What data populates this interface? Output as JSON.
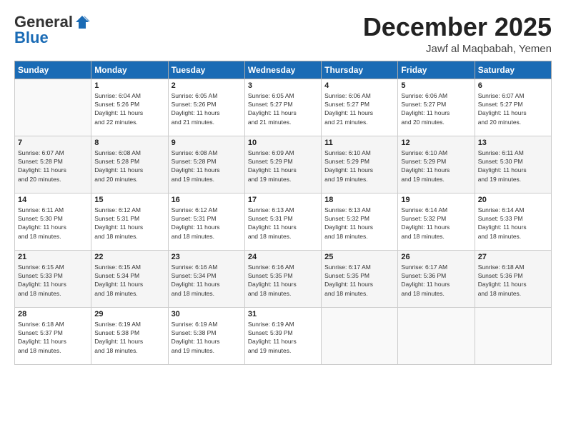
{
  "header": {
    "logo_general": "General",
    "logo_blue": "Blue",
    "month_title": "December 2025",
    "location": "Jawf al Maqbabah, Yemen"
  },
  "days_of_week": [
    "Sunday",
    "Monday",
    "Tuesday",
    "Wednesday",
    "Thursday",
    "Friday",
    "Saturday"
  ],
  "weeks": [
    [
      {
        "day": "",
        "info": ""
      },
      {
        "day": "1",
        "info": "Sunrise: 6:04 AM\nSunset: 5:26 PM\nDaylight: 11 hours\nand 22 minutes."
      },
      {
        "day": "2",
        "info": "Sunrise: 6:05 AM\nSunset: 5:26 PM\nDaylight: 11 hours\nand 21 minutes."
      },
      {
        "day": "3",
        "info": "Sunrise: 6:05 AM\nSunset: 5:27 PM\nDaylight: 11 hours\nand 21 minutes."
      },
      {
        "day": "4",
        "info": "Sunrise: 6:06 AM\nSunset: 5:27 PM\nDaylight: 11 hours\nand 21 minutes."
      },
      {
        "day": "5",
        "info": "Sunrise: 6:06 AM\nSunset: 5:27 PM\nDaylight: 11 hours\nand 20 minutes."
      },
      {
        "day": "6",
        "info": "Sunrise: 6:07 AM\nSunset: 5:27 PM\nDaylight: 11 hours\nand 20 minutes."
      }
    ],
    [
      {
        "day": "7",
        "info": "Sunrise: 6:07 AM\nSunset: 5:28 PM\nDaylight: 11 hours\nand 20 minutes."
      },
      {
        "day": "8",
        "info": "Sunrise: 6:08 AM\nSunset: 5:28 PM\nDaylight: 11 hours\nand 20 minutes."
      },
      {
        "day": "9",
        "info": "Sunrise: 6:08 AM\nSunset: 5:28 PM\nDaylight: 11 hours\nand 19 minutes."
      },
      {
        "day": "10",
        "info": "Sunrise: 6:09 AM\nSunset: 5:29 PM\nDaylight: 11 hours\nand 19 minutes."
      },
      {
        "day": "11",
        "info": "Sunrise: 6:10 AM\nSunset: 5:29 PM\nDaylight: 11 hours\nand 19 minutes."
      },
      {
        "day": "12",
        "info": "Sunrise: 6:10 AM\nSunset: 5:29 PM\nDaylight: 11 hours\nand 19 minutes."
      },
      {
        "day": "13",
        "info": "Sunrise: 6:11 AM\nSunset: 5:30 PM\nDaylight: 11 hours\nand 19 minutes."
      }
    ],
    [
      {
        "day": "14",
        "info": "Sunrise: 6:11 AM\nSunset: 5:30 PM\nDaylight: 11 hours\nand 18 minutes."
      },
      {
        "day": "15",
        "info": "Sunrise: 6:12 AM\nSunset: 5:31 PM\nDaylight: 11 hours\nand 18 minutes."
      },
      {
        "day": "16",
        "info": "Sunrise: 6:12 AM\nSunset: 5:31 PM\nDaylight: 11 hours\nand 18 minutes."
      },
      {
        "day": "17",
        "info": "Sunrise: 6:13 AM\nSunset: 5:31 PM\nDaylight: 11 hours\nand 18 minutes."
      },
      {
        "day": "18",
        "info": "Sunrise: 6:13 AM\nSunset: 5:32 PM\nDaylight: 11 hours\nand 18 minutes."
      },
      {
        "day": "19",
        "info": "Sunrise: 6:14 AM\nSunset: 5:32 PM\nDaylight: 11 hours\nand 18 minutes."
      },
      {
        "day": "20",
        "info": "Sunrise: 6:14 AM\nSunset: 5:33 PM\nDaylight: 11 hours\nand 18 minutes."
      }
    ],
    [
      {
        "day": "21",
        "info": "Sunrise: 6:15 AM\nSunset: 5:33 PM\nDaylight: 11 hours\nand 18 minutes."
      },
      {
        "day": "22",
        "info": "Sunrise: 6:15 AM\nSunset: 5:34 PM\nDaylight: 11 hours\nand 18 minutes."
      },
      {
        "day": "23",
        "info": "Sunrise: 6:16 AM\nSunset: 5:34 PM\nDaylight: 11 hours\nand 18 minutes."
      },
      {
        "day": "24",
        "info": "Sunrise: 6:16 AM\nSunset: 5:35 PM\nDaylight: 11 hours\nand 18 minutes."
      },
      {
        "day": "25",
        "info": "Sunrise: 6:17 AM\nSunset: 5:35 PM\nDaylight: 11 hours\nand 18 minutes."
      },
      {
        "day": "26",
        "info": "Sunrise: 6:17 AM\nSunset: 5:36 PM\nDaylight: 11 hours\nand 18 minutes."
      },
      {
        "day": "27",
        "info": "Sunrise: 6:18 AM\nSunset: 5:36 PM\nDaylight: 11 hours\nand 18 minutes."
      }
    ],
    [
      {
        "day": "28",
        "info": "Sunrise: 6:18 AM\nSunset: 5:37 PM\nDaylight: 11 hours\nand 18 minutes."
      },
      {
        "day": "29",
        "info": "Sunrise: 6:19 AM\nSunset: 5:38 PM\nDaylight: 11 hours\nand 18 minutes."
      },
      {
        "day": "30",
        "info": "Sunrise: 6:19 AM\nSunset: 5:38 PM\nDaylight: 11 hours\nand 19 minutes."
      },
      {
        "day": "31",
        "info": "Sunrise: 6:19 AM\nSunset: 5:39 PM\nDaylight: 11 hours\nand 19 minutes."
      },
      {
        "day": "",
        "info": ""
      },
      {
        "day": "",
        "info": ""
      },
      {
        "day": "",
        "info": ""
      }
    ]
  ]
}
